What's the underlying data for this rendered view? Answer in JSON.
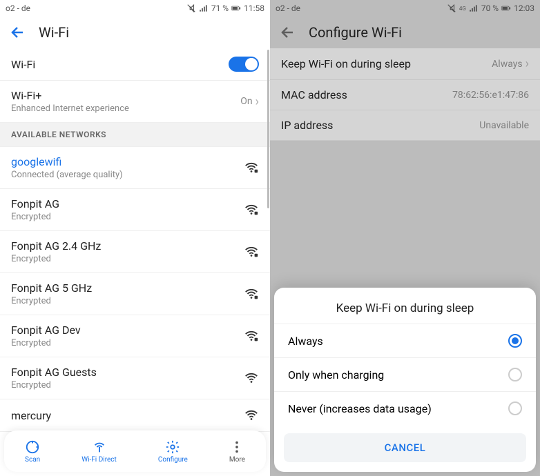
{
  "left": {
    "status": {
      "carrier": "o2 - de",
      "battery": "71 %",
      "time": "11:58"
    },
    "title": "Wi-Fi",
    "wifi_toggle_label": "Wi-Fi",
    "wifi_plus": {
      "title": "Wi-Fi+",
      "sub": "Enhanced Internet experience",
      "value": "On"
    },
    "section": "AVAILABLE NETWORKS",
    "networks": [
      {
        "name": "googlewifi",
        "sub": "Connected (average quality)",
        "connected": true,
        "locked": true
      },
      {
        "name": "Fonpit AG",
        "sub": "Encrypted",
        "locked": true
      },
      {
        "name": "Fonpit AG 2.4 GHz",
        "sub": "Encrypted",
        "locked": true
      },
      {
        "name": "Fonpit AG 5 GHz",
        "sub": "Encrypted",
        "locked": true
      },
      {
        "name": "Fonpit AG Dev",
        "sub": "Encrypted",
        "locked": true
      },
      {
        "name": "Fonpit AG Guests",
        "sub": "Encrypted",
        "locked": false
      },
      {
        "name": "mercury",
        "sub": "",
        "locked": false
      }
    ],
    "nav": {
      "scan": "Scan",
      "direct": "Wi-Fi Direct",
      "configure": "Configure",
      "more": "More"
    }
  },
  "right": {
    "status": {
      "carrier": "o2 - de",
      "battery": "70 %",
      "time": "12:03"
    },
    "title": "Configure Wi-Fi",
    "rows": {
      "sleep": {
        "label": "Keep Wi-Fi on during sleep",
        "value": "Always"
      },
      "mac": {
        "label": "MAC address",
        "value": "78:62:56:e1:47:86"
      },
      "ip": {
        "label": "IP address",
        "value": "Unavailable"
      }
    },
    "dialog": {
      "title": "Keep Wi-Fi on during sleep",
      "options": [
        {
          "label": "Always",
          "checked": true
        },
        {
          "label": "Only when charging",
          "checked": false
        },
        {
          "label": "Never (increases data usage)",
          "checked": false
        }
      ],
      "cancel": "CANCEL"
    }
  }
}
